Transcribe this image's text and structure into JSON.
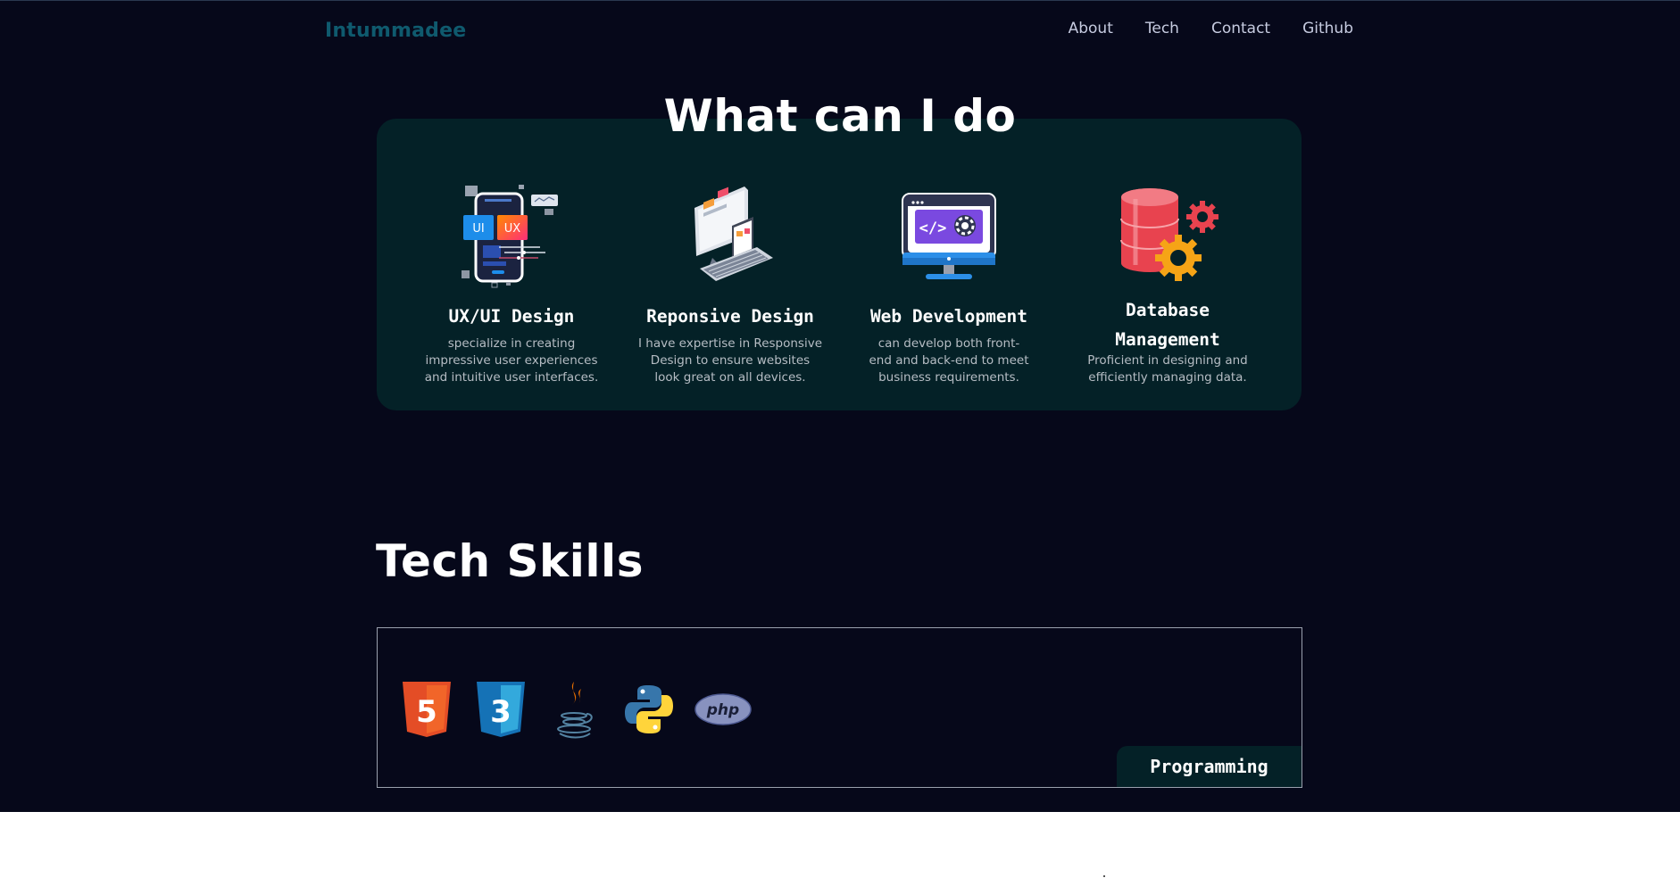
{
  "brand": "Intummadee",
  "nav": {
    "links": [
      "About",
      "Tech",
      "Contact",
      "Github"
    ]
  },
  "services_section": {
    "title": "What can I do",
    "items": [
      {
        "icon": "ux-ui-design-icon",
        "title": "UX/UI Design",
        "desc": [
          "specialize in creating",
          "impressive user experiences",
          "and intuitive user interfaces."
        ]
      },
      {
        "icon": "responsive-design-icon",
        "title": "Reponsive Design",
        "desc": [
          "I have expertise in Responsive",
          "Design to ensure websites",
          "look great on all devices."
        ]
      },
      {
        "icon": "web-development-icon",
        "title": "Web Development",
        "desc": [
          "can develop both front-",
          "end and back-end to meet",
          "business requirements."
        ]
      },
      {
        "icon": "database-management-icon",
        "title": [
          "Database",
          "Management"
        ],
        "desc": [
          "Proficient in designing and",
          "efficiently managing data."
        ]
      }
    ]
  },
  "tech_section": {
    "title": "Tech Skills",
    "category": "Programming",
    "skills": [
      {
        "icon": "html5-icon",
        "badge": "5"
      },
      {
        "icon": "css3-icon",
        "badge": "3"
      },
      {
        "icon": "java-icon"
      },
      {
        "icon": "python-icon"
      },
      {
        "icon": "php-icon",
        "label": "php"
      }
    ]
  },
  "colors": {
    "background": "#06081a",
    "card": "#042127",
    "brand": "#0f5a6e",
    "text": "#ffffff"
  }
}
